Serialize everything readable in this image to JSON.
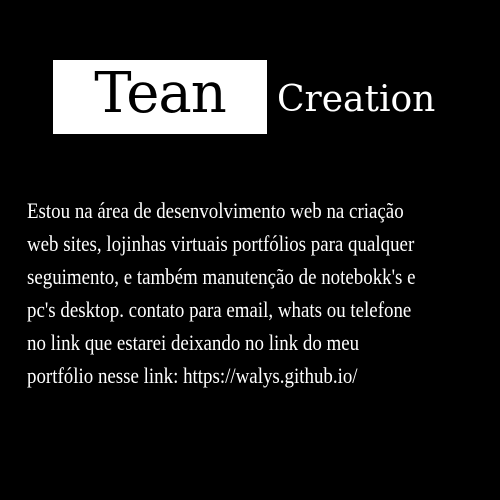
{
  "logo": {
    "main_word": "Tean",
    "second_word": "Creation"
  },
  "description": {
    "lines": [
      "Estou na área de desenvolvimento web na criação",
      "web sites, lojinhas virtuais portfólios para qualquer",
      "seguimento, e também manutenção de notebokk's e",
      "pc's desktop. contato para email, whats ou telefone",
      "no link que estarei deixando no link do meu",
      "portfólio nesse link: https://walys.github.io/"
    ]
  },
  "colors": {
    "background": "#000000",
    "text": "#ffffff",
    "logo_box": "#ffffff",
    "logo_box_text": "#000000"
  }
}
